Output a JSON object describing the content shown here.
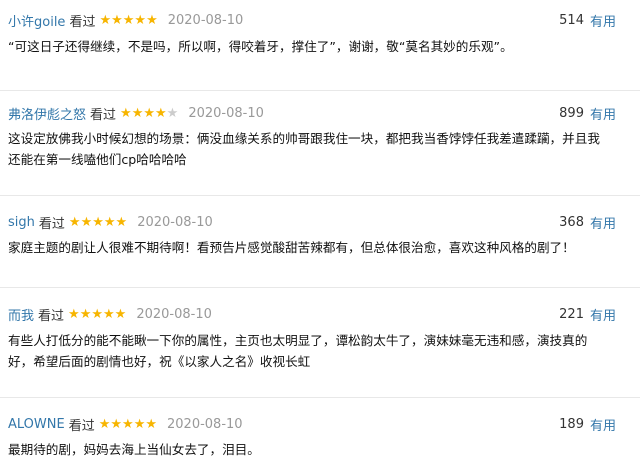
{
  "reviews": [
    {
      "user": "小许goile",
      "verb": "看过",
      "rating": 5,
      "date": "2020-08-10",
      "votes": "514",
      "useful": "有用",
      "lines": [
        "“可这日子还得继续，不是吗，所以啊，得咬着牙，撑住了”，谢谢，敬“莫名其妙的乐观”。"
      ]
    },
    {
      "user": "弗洛伊彪之怒",
      "verb": "看过",
      "rating": 4,
      "date": "2020-08-10",
      "votes": "899",
      "useful": "有用",
      "lines": [
        "这设定放佛我小时候幻想的场景：俩没血缘关系的帅哥跟我住一块，都把我当香饽饽任我差遣蹂躏，并且我",
        "还能在第一线嗑他们cp哈哈哈哈"
      ]
    },
    {
      "user": "sigh",
      "verb": "看过",
      "rating": 5,
      "date": "2020-08-10",
      "votes": "368",
      "useful": "有用",
      "lines": [
        "家庭主题的剧让人很难不期待啊！看预告片感觉酸甜苦辣都有，但总体很治愈，喜欢这种风格的剧了！"
      ]
    },
    {
      "user": "而我",
      "verb": "看过",
      "rating": 5,
      "date": "2020-08-10",
      "votes": "221",
      "useful": "有用",
      "lines": [
        "有些人打低分的能不能瞅一下你的属性，主页也太明显了，谭松韵太牛了，演妹妹毫无违和感，演技真的",
        "好，希望后面的剧情也好，祝《以家人之名》收视长虹"
      ]
    },
    {
      "user": "ALOWNE",
      "verb": "看过",
      "rating": 5,
      "date": "2020-08-10",
      "votes": "189",
      "useful": "有用",
      "lines": [
        "最期待的剧，妈妈去海上当仙女去了，泪目。"
      ]
    }
  ],
  "colors": {
    "user_link": "#3377aa",
    "star_on": "#f7b500",
    "star_off": "#cccccc",
    "date": "#999999"
  }
}
